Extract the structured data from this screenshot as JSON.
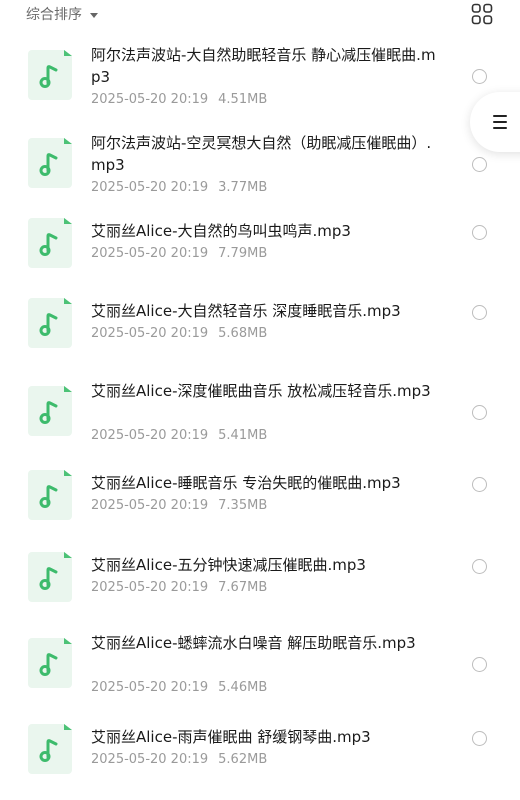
{
  "toolbar": {
    "sort_label": "综合排序",
    "sort_icon": "caret-down-icon",
    "view_icon": "grid-view-icon"
  },
  "float_menu": {
    "icon": "menu-icon"
  },
  "files": [
    {
      "name": "阿尔法声波站-大自然助眠轻音乐 静心减压催眠曲.mp3",
      "date": "2025-05-20 20:19",
      "size": "4.51MB"
    },
    {
      "name": "阿尔法声波站-空灵冥想大自然（助眠减压催眠曲）.mp3",
      "date": "2025-05-20 20:19",
      "size": "3.77MB"
    },
    {
      "name": "艾丽丝Alice-大自然的鸟叫虫鸣声.mp3",
      "date": "2025-05-20 20:19",
      "size": "7.79MB"
    },
    {
      "name": "艾丽丝Alice-大自然轻音乐 深度睡眠音乐.mp3",
      "date": "2025-05-20 20:19",
      "size": "5.68MB"
    },
    {
      "name": "艾丽丝Alice-深度催眠曲音乐 放松减压轻音乐.mp3",
      "date": "2025-05-20 20:19",
      "size": "5.41MB"
    },
    {
      "name": "艾丽丝Alice-睡眠音乐 专治失眠的催眠曲.mp3",
      "date": "2025-05-20 20:19",
      "size": "7.35MB"
    },
    {
      "name": "艾丽丝Alice-五分钟快速减压催眠曲.mp3",
      "date": "2025-05-20 20:19",
      "size": "7.67MB"
    },
    {
      "name": "艾丽丝Alice-蟋蟀流水白噪音 解压助眠音乐.mp3",
      "date": "2025-05-20 20:19",
      "size": "5.46MB"
    },
    {
      "name": "艾丽丝Alice-雨声催眠曲 舒缓钢琴曲.mp3",
      "date": "2025-05-20 20:19",
      "size": "5.62MB"
    }
  ],
  "colors": {
    "accent": "#3dbb6c",
    "icon_bg": "#eaf6ee",
    "meta_text": "#9a9a9a"
  }
}
